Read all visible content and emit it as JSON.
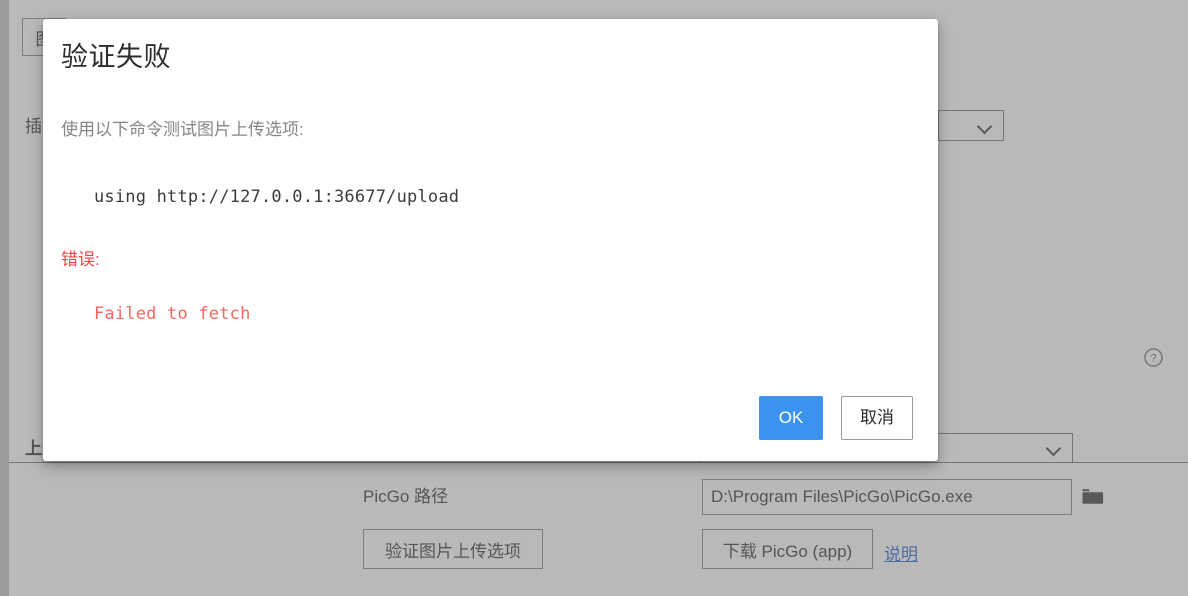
{
  "background": {
    "tab_label": "图",
    "plugin_label": "插",
    "upload_label": "上",
    "picgo_path_label": "PicGo 路径",
    "picgo_path_value": "D:\\Program Files\\PicGo\\PicGo.exe",
    "validate_button": "验证图片上传选项",
    "download_button": "下载 PicGo (app)",
    "instructions_link": "说明",
    "folder_icon": "folder-icon",
    "help_icon": "help-circle-icon",
    "chevron_icon": "chevron-down-icon",
    "top_select_value": "",
    "bottom_select_value": ""
  },
  "dialog": {
    "title": "验证失败",
    "intro": "使用以下命令测试图片上传选项:",
    "command": "using http://127.0.0.1:36677/upload",
    "error_label": "错误:",
    "error_message": "Failed to fetch",
    "ok_label": "OK",
    "cancel_label": "取消"
  },
  "colors": {
    "accent": "#3b93f0",
    "error_label": "#ef4444",
    "error_text": "#f4685f",
    "link": "#1155cc",
    "muted_text": "#868686",
    "scrim": "#808080"
  }
}
